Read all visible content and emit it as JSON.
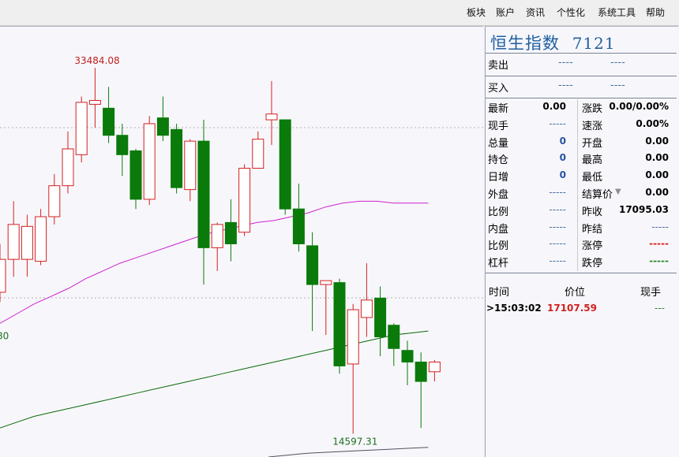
{
  "menu": [
    "板块",
    "账户",
    "资讯",
    "个性化",
    "系统工具",
    "帮助"
  ],
  "panel": {
    "title": "恒生指数",
    "code": "7121",
    "sell": {
      "label": "卖出",
      "v1": "----",
      "v2": "----"
    },
    "buy": {
      "label": "买入",
      "v1": "----",
      "v2": "----"
    },
    "left_rows": [
      {
        "label": "最新",
        "value": "0.00"
      },
      {
        "label": "现手",
        "value": "-----"
      },
      {
        "label": "总量",
        "value": "0"
      },
      {
        "label": "持仓",
        "value": "0"
      },
      {
        "label": "日增",
        "value": "0"
      },
      {
        "label": "外盘",
        "value": "-----"
      },
      {
        "label": "比例",
        "value": "-----"
      },
      {
        "label": "内盘",
        "value": "-----"
      },
      {
        "label": "比例",
        "value": "-----"
      },
      {
        "label": "杠杆",
        "value": "-----"
      }
    ],
    "right_rows": [
      {
        "label": "涨跌",
        "value": "0.00/0.00%"
      },
      {
        "label": "速涨",
        "value": "0.00%"
      },
      {
        "label": "开盘",
        "value": "0.00"
      },
      {
        "label": "最高",
        "value": "0.00"
      },
      {
        "label": "最低",
        "value": "0.00"
      },
      {
        "label": "结算价",
        "value": "0.00"
      },
      {
        "label": "昨收",
        "value": "17095.03"
      },
      {
        "label": "昨结",
        "value": "-----"
      },
      {
        "label": "涨停",
        "value": "-----"
      },
      {
        "label": "跌停",
        "value": "-----"
      }
    ],
    "tick_headers": {
      "time": "时间",
      "price": "价位",
      "vol": "现手"
    },
    "ticks": [
      {
        "time": ">15:03:02",
        "price": "17107.59",
        "vol": "---"
      }
    ]
  },
  "colors": {
    "up": "#d42020",
    "down": "#0a7a0a",
    "ma_short": "#d020d0",
    "ma_long": "#0a6a0a",
    "ma_longest": "#505060"
  },
  "chart_data": {
    "type": "candlestick",
    "annotations": {
      "high_label": "33484.08",
      "low_label": "14597.31",
      "left_edge_label": "80"
    },
    "ylim": [
      13400,
      35600
    ],
    "candles": [
      {
        "o": 21900,
        "c": 23600,
        "h": 24400,
        "l": 21400
      },
      {
        "o": 23600,
        "c": 25400,
        "h": 26600,
        "l": 22700
      },
      {
        "o": 23600,
        "c": 25300,
        "h": 25900,
        "l": 22700
      },
      {
        "o": 23500,
        "c": 25800,
        "h": 26200,
        "l": 23300
      },
      {
        "o": 25800,
        "c": 27400,
        "h": 28000,
        "l": 25400
      },
      {
        "o": 27400,
        "c": 29300,
        "h": 30200,
        "l": 27000
      },
      {
        "o": 29000,
        "c": 31700,
        "h": 32000,
        "l": 28600
      },
      {
        "o": 31600,
        "c": 31800,
        "h": 33484.08,
        "l": 30400
      },
      {
        "o": 31400,
        "c": 30000,
        "h": 32500,
        "l": 29600
      },
      {
        "o": 30000,
        "c": 29000,
        "h": 30600,
        "l": 27900
      },
      {
        "o": 29200,
        "c": 26700,
        "h": 29300,
        "l": 26200
      },
      {
        "o": 26700,
        "c": 30600,
        "h": 31000,
        "l": 26400
      },
      {
        "o": 30900,
        "c": 30000,
        "h": 32000,
        "l": 29700
      },
      {
        "o": 30300,
        "c": 27300,
        "h": 30600,
        "l": 27000
      },
      {
        "o": 27200,
        "c": 29700,
        "h": 29800,
        "l": 26600
      },
      {
        "o": 29700,
        "c": 24200,
        "h": 30800,
        "l": 22300
      },
      {
        "o": 24200,
        "c": 25400,
        "h": 25500,
        "l": 23000
      },
      {
        "o": 25500,
        "c": 24400,
        "h": 26700,
        "l": 23500
      },
      {
        "o": 25000,
        "c": 28300,
        "h": 28500,
        "l": 24800
      },
      {
        "o": 28300,
        "c": 29800,
        "h": 30200,
        "l": 28300
      },
      {
        "o": 30800,
        "c": 31100,
        "h": 32800,
        "l": 29500
      },
      {
        "o": 30800,
        "c": 26200,
        "h": 30800,
        "l": 25900
      },
      {
        "o": 26200,
        "c": 24400,
        "h": 27500,
        "l": 24000
      },
      {
        "o": 24300,
        "c": 22300,
        "h": 25000,
        "l": 19900
      },
      {
        "o": 22300,
        "c": 22500,
        "h": 22500,
        "l": 19700
      },
      {
        "o": 22400,
        "c": 18100,
        "h": 22600,
        "l": 17700
      },
      {
        "o": 18200,
        "c": 21000,
        "h": 21300,
        "l": 14597.31
      },
      {
        "o": 20600,
        "c": 21500,
        "h": 23400,
        "l": 19600
      },
      {
        "o": 21600,
        "c": 19600,
        "h": 22200,
        "l": 18600
      },
      {
        "o": 20200,
        "c": 19000,
        "h": 20300,
        "l": 18100
      },
      {
        "o": 18900,
        "c": 18300,
        "h": 19400,
        "l": 17100
      },
      {
        "o": 18300,
        "c": 17300,
        "h": 18800,
        "l": 14900
      },
      {
        "o": 17800,
        "c": 18300,
        "h": 18400,
        "l": 17300
      }
    ],
    "ma_short": [
      20300,
      20800,
      21300,
      21700,
      22100,
      22600,
      23000,
      23400,
      23700,
      24000,
      24300,
      24600,
      24900,
      25100,
      25300,
      25500,
      25600,
      25800,
      26000,
      26300,
      26500,
      26600,
      26600,
      26500,
      26500,
      26500
    ],
    "ma_long": [
      14900,
      15200,
      15500,
      15700,
      15900,
      16100,
      16300,
      16500,
      16700,
      16900,
      17100,
      17300,
      17500,
      17700,
      17900,
      18100,
      18300,
      18500,
      18700,
      18900,
      19100,
      19300,
      19500,
      19700,
      19800,
      19900
    ],
    "ma_longest": [
      13400,
      13600,
      13700,
      13800,
      13900
    ]
  }
}
